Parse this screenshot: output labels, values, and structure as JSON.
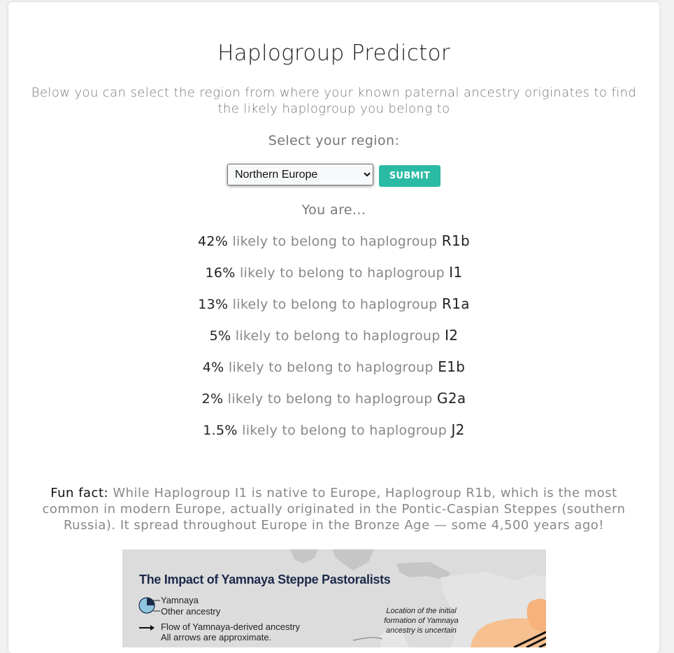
{
  "page": {
    "title": "Haplogroup Predictor",
    "intro": "Below you can select the region from where your known paternal ancestry originates to find the likely haplogroup you belong to",
    "select_label": "Select your region:",
    "region_select": {
      "selected": "Northern Europe"
    },
    "submit_label": "SUBMIT",
    "result_intro": "You are...",
    "result_middle": "likely to belong to haplogroup",
    "results": [
      {
        "percent": "42%",
        "haplogroup": "R1b"
      },
      {
        "percent": "16%",
        "haplogroup": "I1"
      },
      {
        "percent": "13%",
        "haplogroup": "R1a"
      },
      {
        "percent": "5%",
        "haplogroup": "I2"
      },
      {
        "percent": "4%",
        "haplogroup": "E1b"
      },
      {
        "percent": "2%",
        "haplogroup": "G2a"
      },
      {
        "percent": "1.5%",
        "haplogroup": "J2"
      }
    ],
    "fun_fact": {
      "lead": "Fun fact:",
      "text": "While Haplogroup I1 is native to Europe, Haplogroup R1b, which is the most common in modern Europe, actually originated in the Pontic-Caspian Steppes (southern Russia). It spread throughout Europe in the Bronze Age — some 4,500 years ago!"
    },
    "map": {
      "title": "The Impact of Yamnaya Steppe Pastoralists",
      "legend_yamnaya": "Yamnaya",
      "legend_other": "Other ancestry",
      "legend_flow": "Flow of Yamnaya-derived ancestry",
      "legend_approx": "All arrows are approximate.",
      "annotation": "Location of the initial formation of Yamnaya ancestry is uncertain"
    }
  },
  "colors": {
    "accent": "#2bbba4",
    "text_dark": "#222222",
    "text_muted": "#888888"
  }
}
